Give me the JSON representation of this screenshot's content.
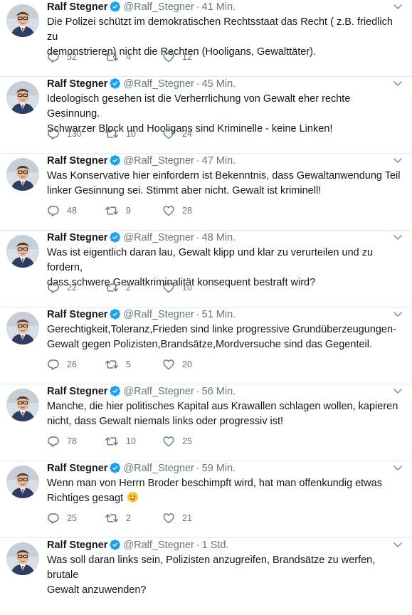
{
  "tweets": [
    {
      "name": "Ralf Stegner",
      "handle": "@Ralf_Stegner",
      "time": "41 Min.",
      "text": "Die Polizei schützt im demokratischen Rechtsstaat das Recht ( z.B. friedlich zu\ndemonstrieren) nicht die Rechten (Hooligans, Gewalttäter).",
      "replies": "52",
      "retweets": "4",
      "likes": "12"
    },
    {
      "name": "Ralf Stegner",
      "handle": "@Ralf_Stegner",
      "time": "45 Min.",
      "text": "Ideologisch gesehen ist die Verherrlichung von Gewalt eher rechte Gesinnung.\nSchwarzer Block und Hooligans sind Kriminelle - keine Linken!",
      "replies": "130",
      "retweets": "10",
      "likes": "24"
    },
    {
      "name": "Ralf Stegner",
      "handle": "@Ralf_Stegner",
      "time": "47 Min.",
      "text": "Was Konservative hier einfordern ist Bekenntnis, dass Gewaltanwendung Teil\nlinker Gesinnung sei. Stimmt aber nicht. Gewalt ist kriminell!",
      "replies": "48",
      "retweets": "9",
      "likes": "28"
    },
    {
      "name": "Ralf Stegner",
      "handle": "@Ralf_Stegner",
      "time": "48 Min.",
      "text": "Was ist eigentlich daran lau, Gewalt klipp und klar zu verurteilen und zu fordern,\ndass schwere Gewaltkriminalität konsequent bestraft wird?",
      "replies": "22",
      "retweets": "2",
      "likes": "10"
    },
    {
      "name": "Ralf Stegner",
      "handle": "@Ralf_Stegner",
      "time": "51 Min.",
      "text": "Gerechtigkeit,Toleranz,Frieden sind linke progressive Grundüberzeugungen-\nGewalt gegen Polizisten,Brandsätze,Mordversuche sind das Gegenteil.",
      "replies": "26",
      "retweets": "5",
      "likes": "20"
    },
    {
      "name": "Ralf Stegner",
      "handle": "@Ralf_Stegner",
      "time": "56 Min.",
      "text": "Manche, die hier politisches Kapital aus Krawallen schlagen wollen, kapieren\nnicht, dass Gewalt niemals links oder progressiv ist!",
      "replies": "78",
      "retweets": "10",
      "likes": "25"
    },
    {
      "name": "Ralf Stegner",
      "handle": "@Ralf_Stegner",
      "time": "59 Min.",
      "text": "Wenn man von Herrn Broder beschimpft wird, hat man offenkundig etwas\nRichtiges gesagt",
      "emoji": "winking-face-emoji",
      "replies": "25",
      "retweets": "2",
      "likes": "21"
    },
    {
      "name": "Ralf Stegner",
      "handle": "@Ralf_Stegner",
      "time": "1 Std.",
      "text": "Was soll daran links sein, Polizisten anzugreifen, Brandsätze zu werfen, brutale\nGewalt anzuwenden?",
      "replies": "",
      "retweets": "",
      "likes": ""
    }
  ],
  "colors": {
    "verified": "#1da1f2",
    "muted": "#657786",
    "text": "#14171a",
    "divider": "#e6ecf0"
  },
  "icons": {
    "reply": "reply-icon",
    "retweet": "retweet-icon",
    "like": "heart-icon",
    "menu": "chevron-down-icon",
    "verified": "verified-badge-icon"
  }
}
